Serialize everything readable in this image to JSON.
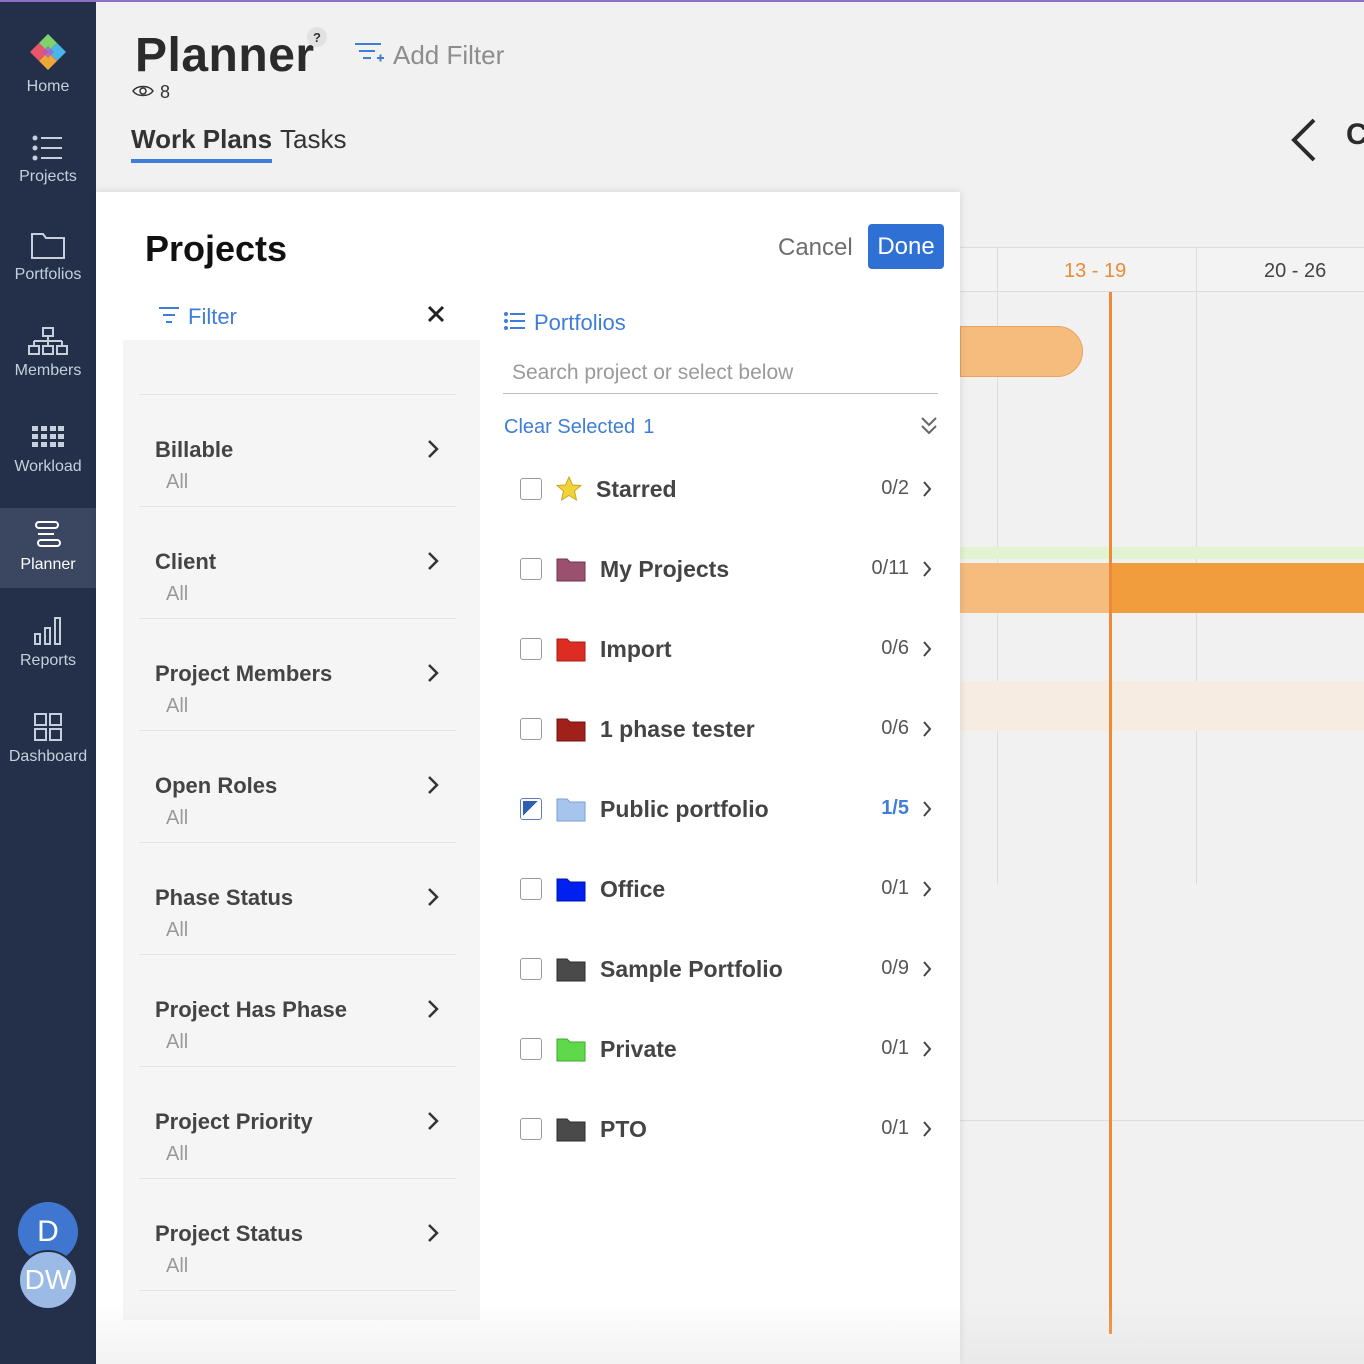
{
  "sidebar": {
    "items": [
      {
        "label": "Home",
        "icon": "home-logo-icon"
      },
      {
        "label": "Projects",
        "icon": "list-icon"
      },
      {
        "label": "Portfolios",
        "icon": "folder-icon"
      },
      {
        "label": "Members",
        "icon": "org-chart-icon"
      },
      {
        "label": "Workload",
        "icon": "grid-icon"
      },
      {
        "label": "Planner",
        "icon": "planner-icon",
        "active": true
      },
      {
        "label": "Reports",
        "icon": "bar-chart-icon"
      },
      {
        "label": "Dashboard",
        "icon": "dashboard-icon"
      }
    ],
    "avatars": {
      "primary": "D",
      "secondary": "DW"
    }
  },
  "header": {
    "title": "Planner",
    "help": "?",
    "add_filter": "Add Filter",
    "watchers_count": "8",
    "tabs": [
      {
        "label": "Work Plans",
        "active": true
      },
      {
        "label": "Tasks"
      }
    ],
    "partial_label": "C"
  },
  "timeline": {
    "weeks": [
      {
        "label": "13 - 19",
        "current": true
      },
      {
        "label": "20 - 26"
      }
    ],
    "accent_color": "#ec8a36"
  },
  "modal": {
    "title": "Projects",
    "cancel_label": "Cancel",
    "done_label": "Done",
    "filter": {
      "header": "Filter",
      "items": [
        {
          "name": "Billable",
          "value": "All"
        },
        {
          "name": "Client",
          "value": "All"
        },
        {
          "name": "Project Members",
          "value": "All"
        },
        {
          "name": "Open Roles",
          "value": "All"
        },
        {
          "name": "Phase Status",
          "value": "All"
        },
        {
          "name": "Project Has Phase",
          "value": "All"
        },
        {
          "name": "Project Priority",
          "value": "All"
        },
        {
          "name": "Project Status",
          "value": "All"
        }
      ]
    },
    "portfolios": {
      "header": "Portfolios",
      "search_placeholder": "Search project or select below",
      "clear_selected_label": "Clear Selected",
      "clear_selected_count": "1",
      "items": [
        {
          "name": "Starred",
          "count": "0/2",
          "icon": "star-icon",
          "color": "#f2d23a",
          "checked": false
        },
        {
          "name": "My Projects",
          "count": "0/11",
          "icon": "folder-icon",
          "color": "#9b5070",
          "checked": false
        },
        {
          "name": "Import",
          "count": "0/6",
          "icon": "folder-icon",
          "color": "#dd2d22",
          "checked": false
        },
        {
          "name": "1 phase tester",
          "count": "0/6",
          "icon": "folder-icon",
          "color": "#a0201a",
          "checked": false
        },
        {
          "name": "Public portfolio",
          "count": "1/5",
          "icon": "folder-icon",
          "color": "#a7c4ee",
          "checked": true
        },
        {
          "name": "Office",
          "count": "0/1",
          "icon": "folder-icon",
          "color": "#0020f0",
          "checked": false
        },
        {
          "name": "Sample Portfolio",
          "count": "0/9",
          "icon": "folder-icon",
          "color": "#4a4a4a",
          "checked": false
        },
        {
          "name": "Private",
          "count": "0/1",
          "icon": "folder-icon",
          "color": "#5fd94a",
          "checked": false
        },
        {
          "name": "PTO",
          "count": "0/1",
          "icon": "folder-icon",
          "color": "#4a4a4a",
          "checked": false
        }
      ]
    }
  },
  "colors": {
    "sidebar_bg": "#24304a",
    "accent_blue": "#2e70d4",
    "link_blue": "#3f7ed8"
  }
}
